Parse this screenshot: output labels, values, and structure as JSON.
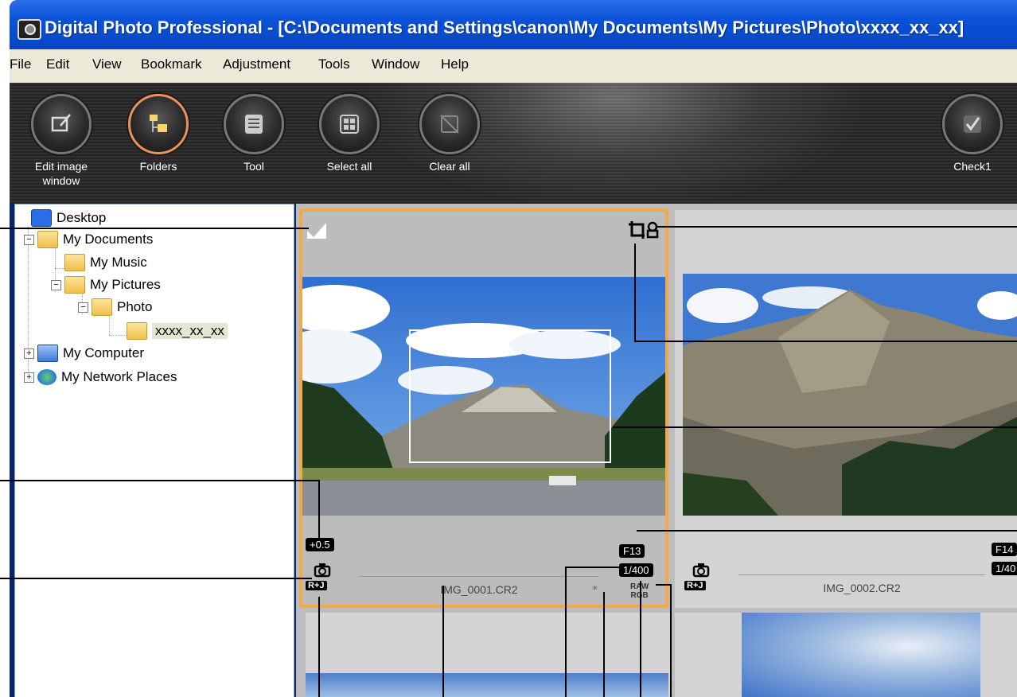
{
  "window": {
    "title": "Digital Photo Professional - [C:\\Documents and Settings\\canon\\My Documents\\My Pictures\\Photo\\xxxx_xx_xx]"
  },
  "menu": [
    "File",
    "Edit",
    "View",
    "Bookmark",
    "Adjustment",
    "Tools",
    "Window",
    "Help"
  ],
  "toolbar": {
    "buttons": [
      {
        "label": "Edit image\nwindow",
        "icon": "edit-image-window-icon"
      },
      {
        "label": "Folders",
        "icon": "folders-icon",
        "active": true
      },
      {
        "label": "Tool",
        "icon": "tool-icon"
      },
      {
        "label": "Select all",
        "icon": "select-all-icon"
      },
      {
        "label": "Clear all",
        "icon": "clear-all-icon"
      },
      {
        "label": "Check1",
        "icon": "check-mark-icon"
      }
    ]
  },
  "tree": {
    "items": [
      {
        "label": "Desktop"
      },
      {
        "label": "My Documents"
      },
      {
        "label": "My Music"
      },
      {
        "label": "My Pictures"
      },
      {
        "label": "Photo"
      },
      {
        "label": "xxxx_xx_xx"
      },
      {
        "label": "My Computer"
      },
      {
        "label": "My Network Places"
      }
    ]
  },
  "thumbnails": [
    {
      "filename": "IMG_0001.CR2",
      "exposure_comp": "+0.5",
      "aperture": "F13",
      "shutter": "1/400",
      "raw": "RAW",
      "rgb": "RGB",
      "type_badge": "R+J",
      "selected": true
    },
    {
      "filename": "IMG_0002.CR2",
      "aperture": "F14",
      "shutter": "1/40",
      "type_badge": "R+J"
    }
  ],
  "colors": {
    "titlebar": "#0a52d8",
    "selection_border": "#f0a84a",
    "menubar": "#ece9d8"
  }
}
